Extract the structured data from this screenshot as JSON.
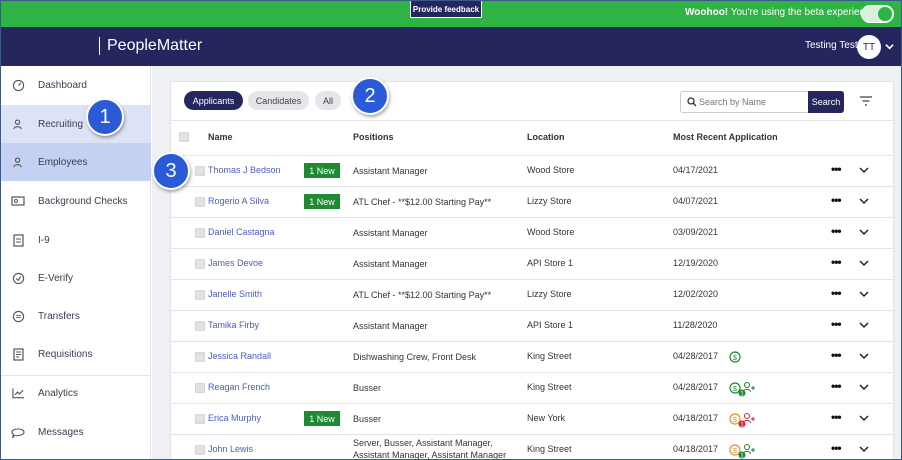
{
  "beta_bar": {
    "feedback_label": "Provide feedback",
    "message_bold": "Woohoo!",
    "message_rest": " You're using the beta experience.",
    "toggle_on": true
  },
  "header": {
    "logo": "PeopleMatter",
    "user_name": "Testing Test",
    "avatar_initials": "TT"
  },
  "sidebar": {
    "items": [
      {
        "label": "Dashboard",
        "icon": "speedometer-icon"
      },
      {
        "label": "Recruiting",
        "icon": "user-plus-icon"
      },
      {
        "label": "Employees",
        "icon": "user-icon"
      },
      {
        "label": "Background Checks",
        "icon": "id-card-icon"
      },
      {
        "label": "I-9",
        "icon": "document-icon"
      },
      {
        "label": "E-Verify",
        "icon": "check-circle-icon"
      },
      {
        "label": "Transfers",
        "icon": "transfer-icon"
      },
      {
        "label": "Requisitions",
        "icon": "requisition-icon"
      },
      {
        "label": "Analytics",
        "icon": "chart-icon"
      },
      {
        "label": "Messages",
        "icon": "chat-icon"
      }
    ]
  },
  "filters": {
    "tabs": [
      "Applicants",
      "Candidates",
      "All"
    ],
    "active_tab": "Applicants"
  },
  "search": {
    "placeholder": "Search by Name",
    "button_label": "Search"
  },
  "table": {
    "columns": [
      "Name",
      "Positions",
      "Location",
      "Most Recent Application"
    ],
    "rows": [
      {
        "name": "Thomas J Bedson",
        "badge": "1 New",
        "positions": "Assistant Manager",
        "positions2": "",
        "location": "Wood Store",
        "date": "04/17/2021",
        "status": ""
      },
      {
        "name": "Rogerio A Silva",
        "badge": "1 New",
        "positions": "ATL Chef - **$12.00 Starting Pay**",
        "positions2": "",
        "location": "Lizzy Store",
        "date": "04/07/2021",
        "status": ""
      },
      {
        "name": "Daniel Castagna",
        "badge": "",
        "positions": "Assistant Manager",
        "positions2": "",
        "location": "Wood Store",
        "date": "03/09/2021",
        "status": ""
      },
      {
        "name": "James Devoe",
        "badge": "",
        "positions": "Assistant Manager",
        "positions2": "",
        "location": "API Store 1",
        "date": "12/19/2020",
        "status": ""
      },
      {
        "name": "Janelle Smith",
        "badge": "",
        "positions": "ATL Chef - **$12.00 Starting Pay**",
        "positions2": "",
        "location": "Lizzy Store",
        "date": "12/02/2020",
        "status": ""
      },
      {
        "name": "Tamika Firby",
        "badge": "",
        "positions": "Assistant Manager",
        "positions2": "",
        "location": "API Store 1",
        "date": "11/28/2020",
        "status": ""
      },
      {
        "name": "Jessica Randall",
        "badge": "",
        "positions": "Dishwashing Crew, Front Desk",
        "positions2": "",
        "location": "King Street",
        "date": "04/28/2017",
        "status": "dollar-green"
      },
      {
        "name": "Reagan French",
        "badge": "",
        "positions": "Busser",
        "positions2": "",
        "location": "King Street",
        "date": "04/28/2017",
        "status": "dollar-green-person-green"
      },
      {
        "name": "Erica Murphy",
        "badge": "1 New",
        "positions": "Busser",
        "positions2": "",
        "location": "New York",
        "date": "04/18/2017",
        "status": "dollar-orange-person-red"
      },
      {
        "name": "John Lewis",
        "badge": "",
        "positions": "Server, Busser, Assistant Manager,",
        "positions2": "Assistant Manager, Assistant Manager",
        "location": "King Street",
        "date": "04/18/2017",
        "status": "dollar-orange-person-green"
      }
    ]
  },
  "callouts": [
    "1",
    "2",
    "3"
  ],
  "colors": {
    "brand_navy": "#25265e",
    "beta_green": "#2fb344",
    "link_blue": "#4a5cc4",
    "badge_green": "#1e8a32",
    "callout_blue": "#2b5ad6"
  }
}
